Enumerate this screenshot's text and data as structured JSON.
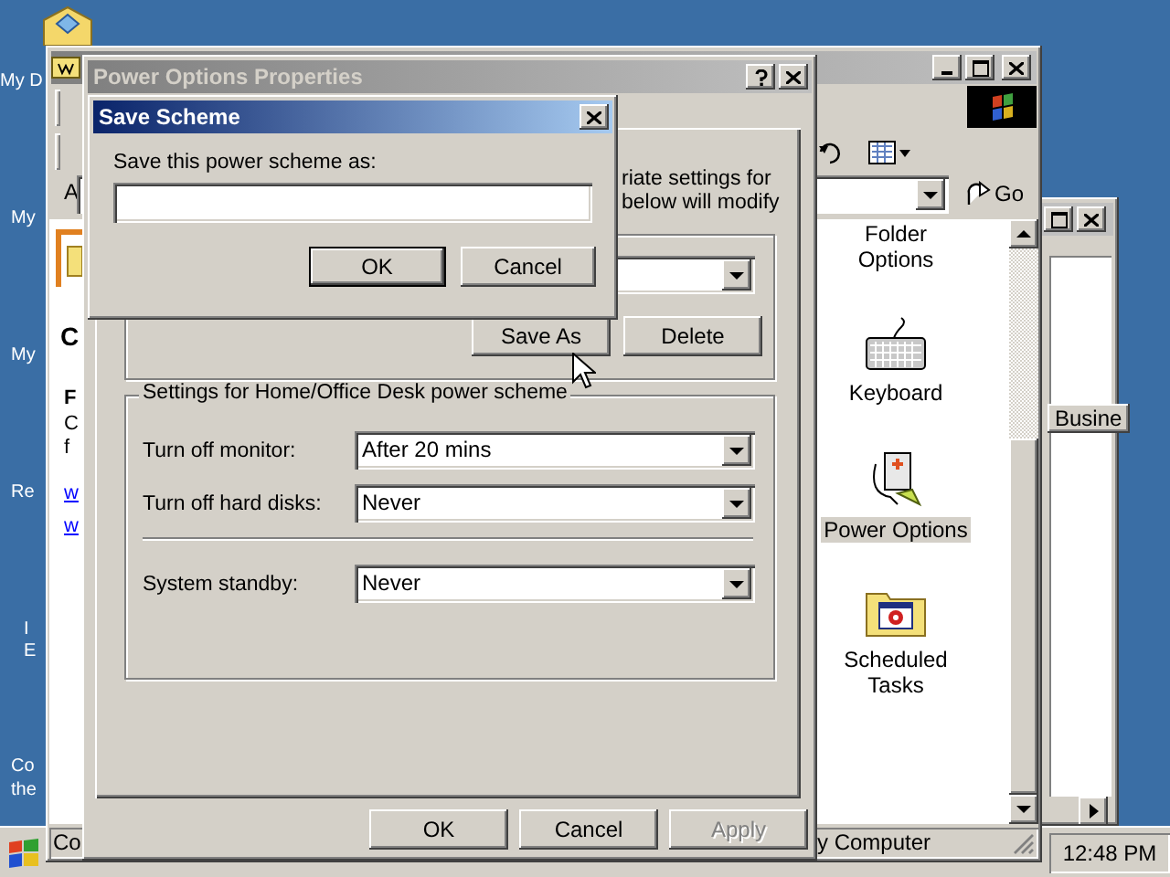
{
  "desktop": {
    "icon_labels": [
      "My D",
      "My",
      "My",
      "Re",
      "I",
      "E",
      "Co",
      "the"
    ]
  },
  "back_window": {
    "column_header": "Busine"
  },
  "control_panel_window": {
    "address_label": "A",
    "go_button": "Go",
    "sidebar_fragments": [
      {
        "text": "C",
        "kind": "heading"
      },
      {
        "text": "F",
        "kind": "bold"
      },
      {
        "text": "C",
        "kind": "plain"
      },
      {
        "text": "f",
        "kind": "plain"
      },
      {
        "text": "w",
        "kind": "link"
      },
      {
        "text": "w",
        "kind": "link"
      }
    ],
    "items": [
      {
        "label": "Folder Options",
        "kind": "partial",
        "selected": false
      },
      {
        "label": "Keyboard",
        "kind": "keyboard",
        "selected": false
      },
      {
        "label": "Power Options",
        "kind": "power",
        "selected": true
      },
      {
        "label": "Scheduled Tasks",
        "kind": "tasks",
        "selected": false
      }
    ],
    "status_panes": [
      "Co",
      "y Computer"
    ]
  },
  "power_options_dialog": {
    "title": "Power Options Properties",
    "active": false,
    "intro_lines": [
      "riate settings for",
      "below will modify"
    ],
    "scheme_buttons": [
      {
        "label": "Save As",
        "disabled": false
      },
      {
        "label": "Delete",
        "disabled": false
      }
    ],
    "settings_group": {
      "title": "Settings for Home/Office Desk power scheme",
      "rows": [
        {
          "label": "Turn off monitor:",
          "value": "After 20 mins",
          "separated": false
        },
        {
          "label": "Turn off hard disks:",
          "value": "Never",
          "separated": false
        },
        {
          "label": "System standby:",
          "value": "Never",
          "separated": true
        }
      ]
    },
    "buttons": [
      {
        "label": "OK",
        "disabled": false
      },
      {
        "label": "Cancel",
        "disabled": false
      },
      {
        "label": "Apply",
        "disabled": true
      }
    ]
  },
  "save_scheme_dialog": {
    "title": "Save Scheme",
    "active": true,
    "prompt": "Save this power scheme as:",
    "buttons": [
      {
        "label": "OK",
        "default": true
      },
      {
        "label": "Cancel",
        "default": false
      }
    ]
  },
  "taskbar": {
    "clock": "12:48 PM"
  }
}
